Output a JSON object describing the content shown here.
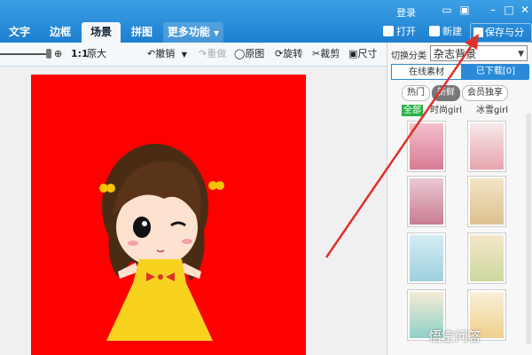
{
  "tabs": [
    {
      "label": "文字"
    },
    {
      "label": "边框"
    },
    {
      "label": "场景",
      "active": true
    },
    {
      "label": "拼图"
    },
    {
      "label": "更多功能"
    }
  ],
  "header": {
    "login": "登录",
    "open": "打开",
    "new": "新建",
    "save_share": "保存与分享"
  },
  "toolbar": {
    "ratio": "1:1",
    "original_size": "原大",
    "undo": "撤销",
    "redo": "重做",
    "original_image": "原图",
    "rotate": "旋转",
    "crop": "裁剪",
    "size": "尺寸"
  },
  "right_panel": {
    "category_label": "切换分类",
    "category_value": "杂志背景",
    "source_tabs": [
      "在线素材",
      "已下载[0]"
    ],
    "filter_pills": [
      "热门",
      "新鲜",
      "会员独享"
    ],
    "subcategories": [
      "全部",
      "时尚girl",
      "冰雪girl"
    ]
  },
  "watermark": "悟空问答",
  "colors": {
    "accent_blue": "#1d7fcf",
    "photo_bg": "#ff0000",
    "annotation_red": "#e0302a",
    "active_green": "#2db34a"
  }
}
